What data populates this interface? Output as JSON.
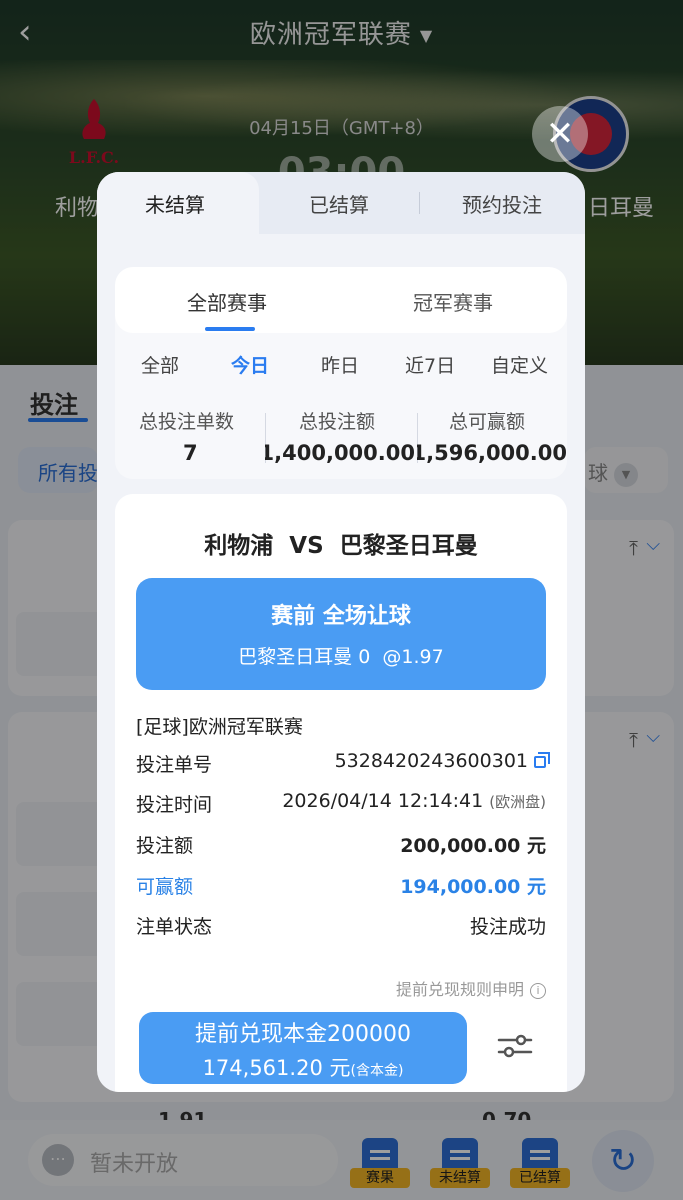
{
  "header": {
    "back_icon": "chevron-left-icon",
    "league_title": "欧洲冠军联赛",
    "dropdown_icon": "caret-down-icon"
  },
  "match_header": {
    "date": "04月15日（GMT+8）",
    "time": "03:00",
    "home_team": "利物",
    "away_team": "日耳曼"
  },
  "background": {
    "bet_tab": "投注",
    "filter_left": "所有投",
    "filter_right": "球",
    "odds_left": "1.91",
    "odds_right": "0.70",
    "chat_placeholder": "暂未开放",
    "dock": [
      {
        "label": "赛果",
        "icon": "results-icon"
      },
      {
        "label": "未结算",
        "icon": "unsettled-icon"
      },
      {
        "label": "已结算",
        "icon": "settled-icon"
      }
    ],
    "refresh_icon": "refresh-icon"
  },
  "modal": {
    "close_icon": "close-icon",
    "tabs": [
      {
        "label": "未结算",
        "active": true
      },
      {
        "label": "已结算",
        "active": false
      },
      {
        "label": "预约投注",
        "active": false
      }
    ],
    "scope_tabs": [
      {
        "label": "全部赛事",
        "active": true
      },
      {
        "label": "冠军赛事",
        "active": false
      }
    ],
    "ranges": [
      {
        "label": "全部",
        "active": false
      },
      {
        "label": "今日",
        "active": true
      },
      {
        "label": "昨日",
        "active": false
      },
      {
        "label": "近7日",
        "active": false
      },
      {
        "label": "自定义",
        "active": false
      }
    ],
    "stats": [
      {
        "label": "总投注单数",
        "value": "7"
      },
      {
        "label": "总投注额",
        "value": "1,400,000.00"
      },
      {
        "label": "总可赢额",
        "value": "1,596,000.00"
      }
    ],
    "bet": {
      "match": "利物浦  VS  巴黎圣日耳曼",
      "market": "赛前 全场让球",
      "pick_team": "巴黎圣日耳曼 0",
      "pick_odds": "@1.97",
      "league": "[足球]欧洲冠军联赛",
      "order_no_label": "投注单号",
      "order_no": "5328420243600301",
      "time_label": "投注时间",
      "time": "2026/04/14 12:14:41",
      "odds_type": "(欧洲盘)",
      "stake_label": "投注额",
      "stake": "200,000.00 元",
      "win_label": "可赢额",
      "win": "194,000.00 元",
      "status_label": "注单状态",
      "status": "投注成功",
      "rules_note": "提前兑现规则申明",
      "cashout_line1": "提前兑现本金200000",
      "cashout_amount": "174,561.20 元",
      "cashout_note": "(含本金)"
    }
  }
}
